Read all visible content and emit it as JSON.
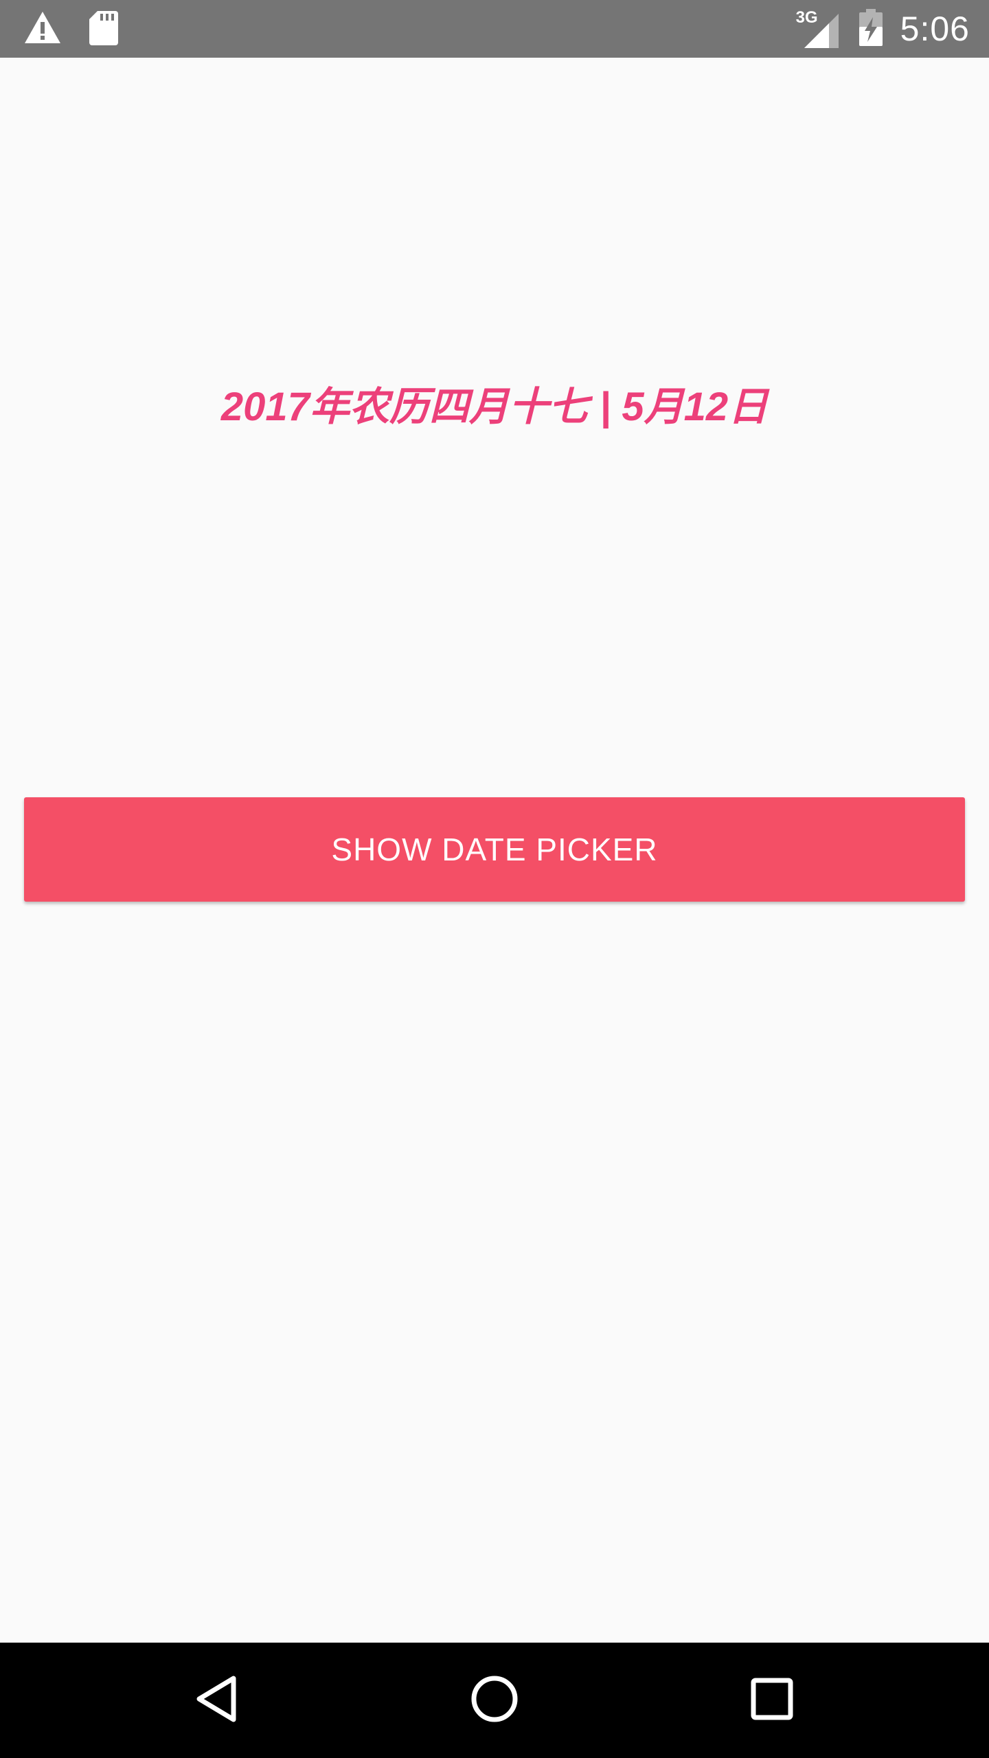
{
  "status_bar": {
    "time": "5:06",
    "network": "3G",
    "icons": [
      "warning-icon",
      "sd-card-icon",
      "signal-icon",
      "battery-charging-icon"
    ]
  },
  "main": {
    "date_label": "2017年农历四月十七 | 5月12日",
    "show_date_picker_label": "SHOW DATE PICKER"
  },
  "nav_bar": {
    "icons": [
      "back-icon",
      "home-icon",
      "recents-icon"
    ]
  },
  "colors": {
    "accent_text": "#ec407a",
    "button_bg": "#f44f66",
    "status_bar_bg": "#757575",
    "nav_bar_bg": "#000000",
    "background": "#fafafa"
  }
}
